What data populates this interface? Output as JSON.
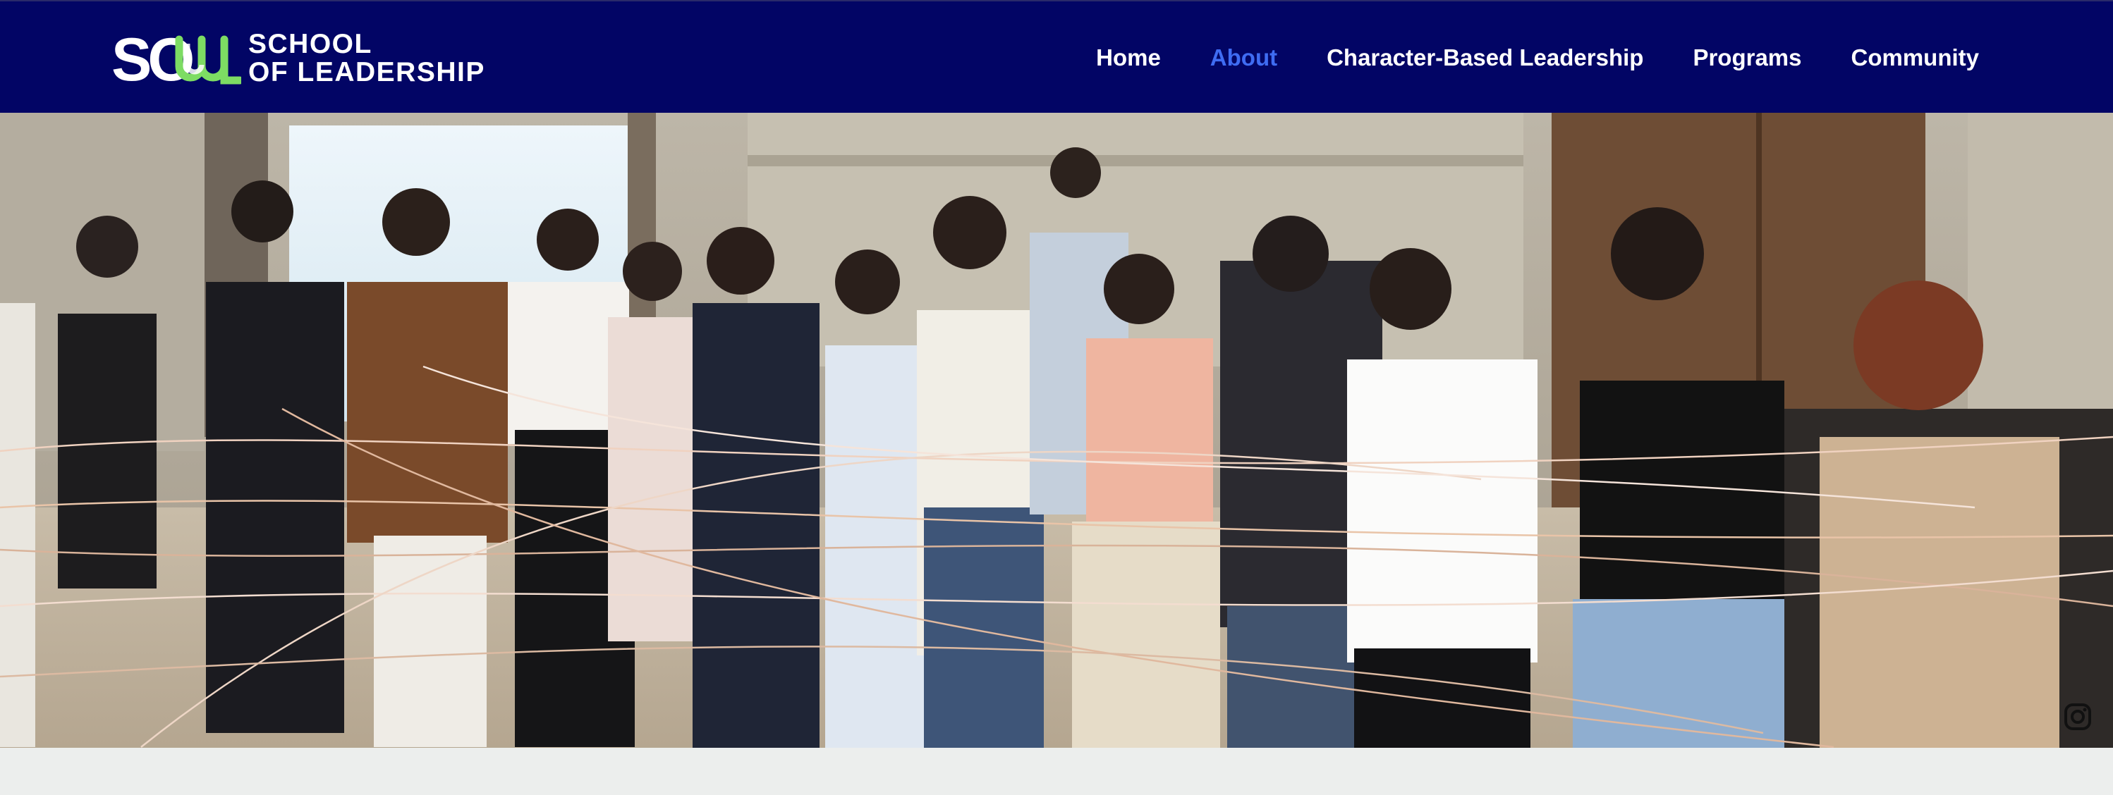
{
  "brand": {
    "mark": "SOUL",
    "line1": "SCHOOL",
    "line2": "OF LEADERSHIP",
    "colors": {
      "header_bg": "#020565",
      "accent": "#3f6cf2",
      "mark_green": "#7ddc63",
      "text": "#ffffff"
    }
  },
  "nav": {
    "items": [
      {
        "label": "Home",
        "active": false
      },
      {
        "label": "About",
        "active": true
      },
      {
        "label": "Character-Based Leadership",
        "active": false
      },
      {
        "label": "Programs",
        "active": false
      },
      {
        "label": "Community",
        "active": false
      }
    ]
  },
  "hero": {
    "image": "photo-of-students-holding-strings-in-team-activity"
  },
  "social": {
    "icons": [
      "instagram-icon",
      "linkedin-icon"
    ]
  }
}
